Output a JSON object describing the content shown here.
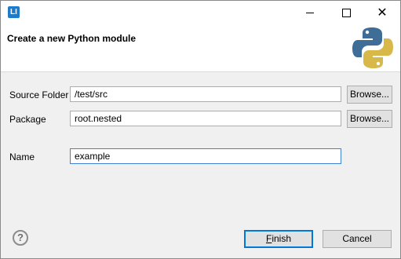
{
  "window": {
    "app_icon_glyph": "LI",
    "controls": {
      "minimize": "minimize-icon",
      "maximize": "maximize-icon",
      "close": "close-icon"
    }
  },
  "banner": {
    "title": "Create a new Python module",
    "logo": "python-logo",
    "colors": {
      "blue": "#3e6e98",
      "yellow": "#d9b84a"
    }
  },
  "form": {
    "source_folder": {
      "label": "Source Folder",
      "value": "/test/src",
      "browse_label": "Browse..."
    },
    "package": {
      "label": "Package",
      "value": "root.nested",
      "browse_label": "Browse..."
    },
    "name": {
      "label": "Name",
      "value": "example"
    }
  },
  "footer": {
    "help_icon": "help-icon",
    "finish_first_letter": "F",
    "finish_rest": "inish",
    "cancel_label": "Cancel"
  }
}
